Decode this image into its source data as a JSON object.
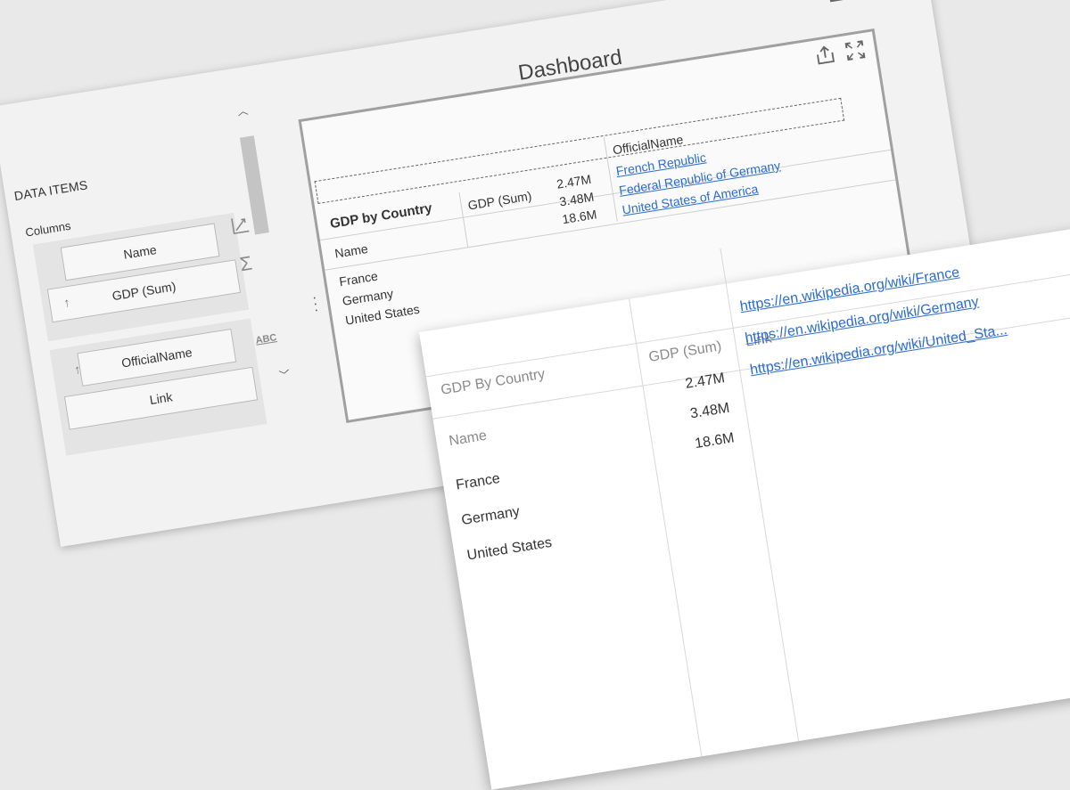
{
  "designer": {
    "left_panel": {
      "title": "DATA ITEMS",
      "columns_label": "Columns",
      "fields": [
        {
          "label": "Name"
        },
        {
          "label": "GDP (Sum)"
        },
        {
          "label": "OfficialName"
        },
        {
          "label": "Link"
        }
      ],
      "abc_label": "ABC",
      "sigma_label": "Σ"
    },
    "dashboard": {
      "title": "Dashboard",
      "grid": {
        "title": "GDP by Country",
        "headers": {
          "name": "Name",
          "gdp": "GDP (Sum)",
          "official": "OfficialName"
        },
        "rows": [
          {
            "name": "France",
            "gdp": "2.47M",
            "official": "French Republic"
          },
          {
            "name": "Germany",
            "gdp": "3.48M",
            "official": "Federal Republic of Germany"
          },
          {
            "name": "United States",
            "gdp": "18.6M",
            "official": "United States of America"
          }
        ]
      }
    }
  },
  "preview": {
    "title": "GDP By Country",
    "headers": {
      "name": "Name",
      "gdp": "GDP (Sum)",
      "link": "Link"
    },
    "rows": [
      {
        "name": "France",
        "gdp": "2.47M",
        "link": "https://en.wikipedia.org/wiki/France"
      },
      {
        "name": "Germany",
        "gdp": "3.48M",
        "link": "https://en.wikipedia.org/wiki/Germany"
      },
      {
        "name": "United States",
        "gdp": "18.6M",
        "link": "https://en.wikipedia.org/wiki/United_Sta..."
      }
    ]
  },
  "colors": {
    "link": "#2b6cd1",
    "frame": "#a0a0a0",
    "background": "#e9e9e9"
  },
  "icons": [
    "export-icon",
    "fullscreen-icon",
    "sort-ascending-icon",
    "coordinate-axis-icon",
    "sigma-icon",
    "abc-icon",
    "chevron-up-icon",
    "chevron-down-icon"
  ]
}
